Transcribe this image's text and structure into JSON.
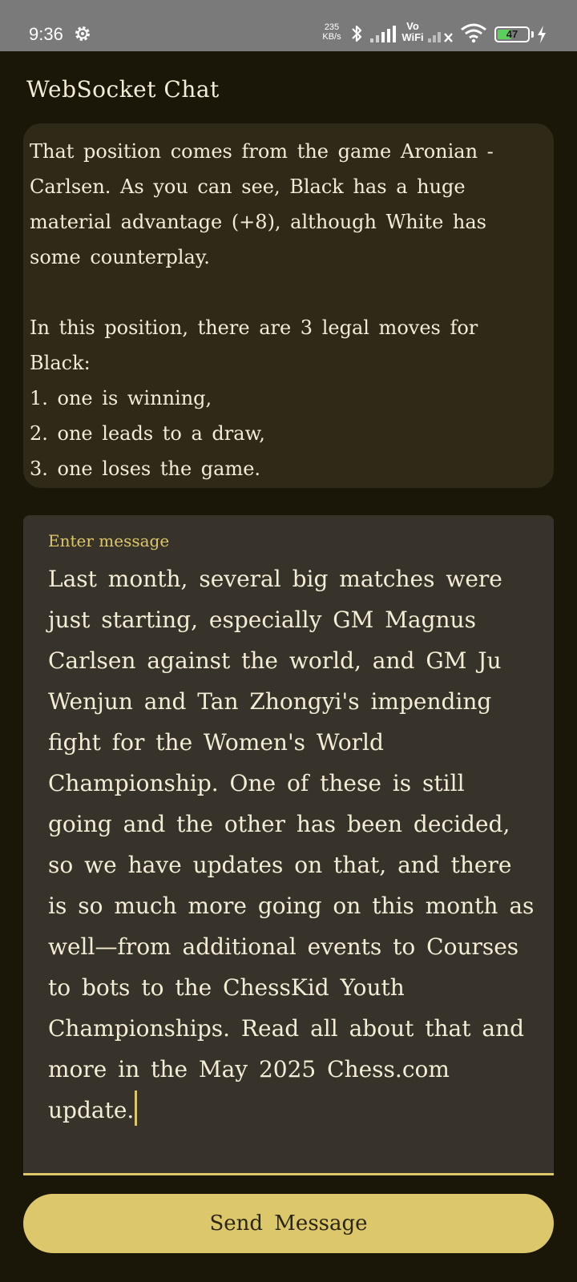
{
  "status_bar": {
    "time": "9:36",
    "net_speed_value": "235",
    "net_speed_unit": "KB/s",
    "vowifi_top": "Vo",
    "vowifi_bottom": "WiFi",
    "battery_level": "47",
    "icons": [
      "settings-gear-icon",
      "bluetooth-icon",
      "signal-icon",
      "signal-no-service-icon",
      "wifi-icon",
      "battery-icon",
      "charging-bolt-icon"
    ],
    "battery_color": "#5ccf5c"
  },
  "app": {
    "title": "WebSocket Chat"
  },
  "messages": [
    {
      "text": "That position comes from the game Aronian - Carlsen. As you can see, Black has a huge material advantage (+8), although White has some counterplay.\n\nIn this position, there are 3 legal moves for Black:\n1. one is winning,\n2. one leads to a draw,\n3. one loses the game."
    }
  ],
  "composer": {
    "label": "Enter message",
    "value": "Last month, several big matches were just starting, especially GM Magnus Carlsen against the world, and GM Ju Wenjun and Tan Zhongyi's impending fight for the Women's World Championship. One of these is still going and the other has been decided, so we have updates on that, and there is so much more going on this month as well—from additional events to Courses to bots to the ChessKid Youth Championships. Read all about that and more in the May 2025 Chess.com update.",
    "send_label": "Send Message"
  },
  "colors": {
    "background": "#1a1608",
    "bubble": "#2f2a18",
    "input": "#38332a",
    "accent": "#ddc76b",
    "text": "#f3ecd6"
  }
}
